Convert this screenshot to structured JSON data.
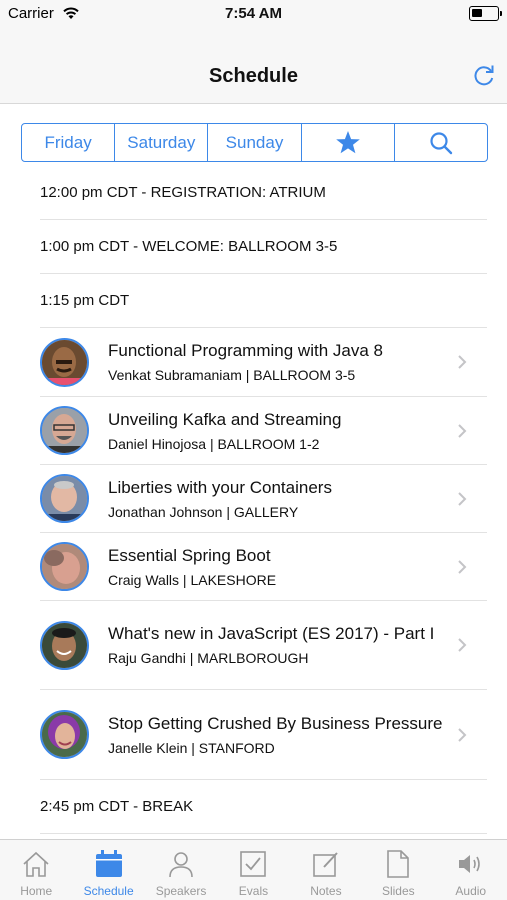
{
  "status": {
    "carrier": "Carrier",
    "time": "7:54 AM",
    "battery_level": 0.45
  },
  "nav": {
    "title": "Schedule"
  },
  "segments": {
    "friday": "Friday",
    "saturday": "Saturday",
    "sunday": "Sunday",
    "favorites_icon": "star-icon",
    "search_icon": "search-icon"
  },
  "schedule": {
    "registration": "12:00 pm CDT - REGISTRATION: ATRIUM",
    "welcome": "1:00 pm CDT - WELCOME: BALLROOM 3-5",
    "slot_115": "1:15 pm CDT",
    "sessions": [
      {
        "title": "Functional Programming with Java 8",
        "subtitle": "Venkat Subramaniam | BALLROOM 3-5"
      },
      {
        "title": "Unveiling Kafka and Streaming",
        "subtitle": "Daniel Hinojosa | BALLROOM 1-2"
      },
      {
        "title": "Liberties with your Containers",
        "subtitle": "Jonathan Johnson | GALLERY"
      },
      {
        "title": "Essential Spring Boot",
        "subtitle": "Craig Walls | LAKESHORE"
      },
      {
        "title": "What's new in JavaScript (ES 2017) - Part I",
        "subtitle": "Raju Gandhi | MARLBOROUGH"
      },
      {
        "title": "Stop Getting Crushed By Business Pressure",
        "subtitle": "Janelle Klein | STANFORD"
      }
    ],
    "break": "2:45 pm CDT - BREAK"
  },
  "tabs": {
    "home": "Home",
    "schedule": "Schedule",
    "speakers": "Speakers",
    "evals": "Evals",
    "notes": "Notes",
    "slides": "Slides",
    "audio": "Audio"
  },
  "colors": {
    "accent": "#3d88e8",
    "inactive": "#999999",
    "bar_bg": "#f7f7f7"
  }
}
